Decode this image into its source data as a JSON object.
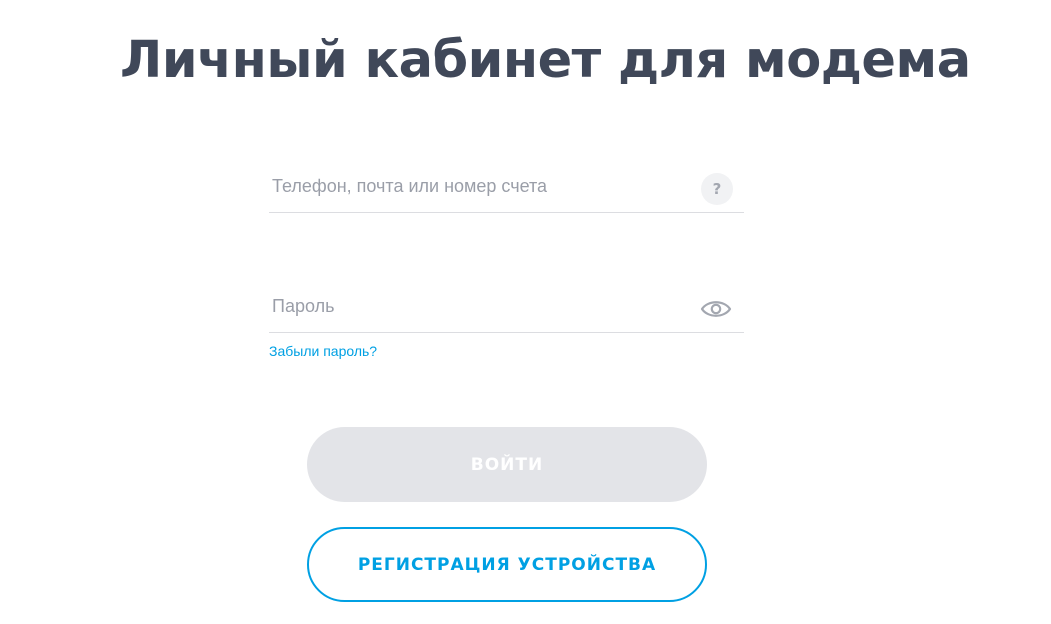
{
  "page": {
    "title": "Личный кабинет для модема"
  },
  "login_form": {
    "login_field": {
      "placeholder": "Телефон, почта или номер счета",
      "value": "",
      "help_icon": "question-icon",
      "help_glyph": "?"
    },
    "password_field": {
      "placeholder": "Пароль",
      "value": "",
      "toggle_icon": "eye-icon"
    },
    "forgot_password_label": "Забыли пароль?",
    "submit_label": "ВОЙТИ",
    "register_label": "РЕГИСТРАЦИЯ УСТРОЙСТВА"
  },
  "colors": {
    "title": "#404859",
    "accent": "#00a0e3",
    "disabled_button": "#e3e4e8",
    "placeholder": "#9a9ea8"
  }
}
